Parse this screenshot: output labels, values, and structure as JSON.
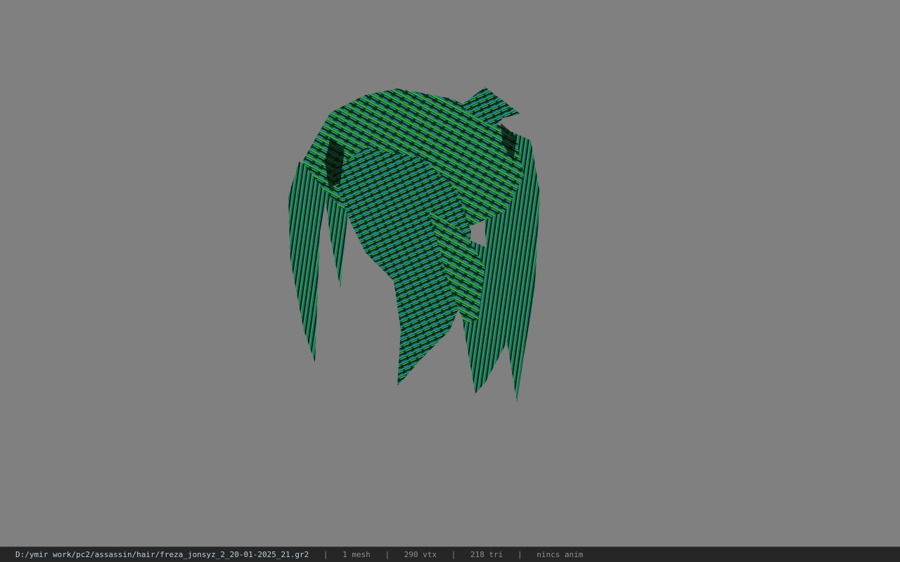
{
  "viewport": {
    "background": "#808080",
    "model": "hair mesh",
    "icon": "3d-model"
  },
  "statusbar": {
    "file_path": "D:/ymir work/pc2/assassin/hair/freza_jonsyz_2_20-01-2025_21.gr2",
    "separator": "|",
    "mesh_count": "1 mesh",
    "vertex_count": "290 vtx",
    "triangle_count": "218 tri",
    "anim_status": "nincs anim"
  },
  "colors": {
    "status_bg": "#262626",
    "path_text": "#b9cfe0",
    "stat_text": "#8f8f8f",
    "hair_dark": "#0a2a14",
    "hair_green": "#2f8f3a",
    "hair_teal": "#1f9f8a",
    "hair_blue": "#2a6fb0"
  }
}
